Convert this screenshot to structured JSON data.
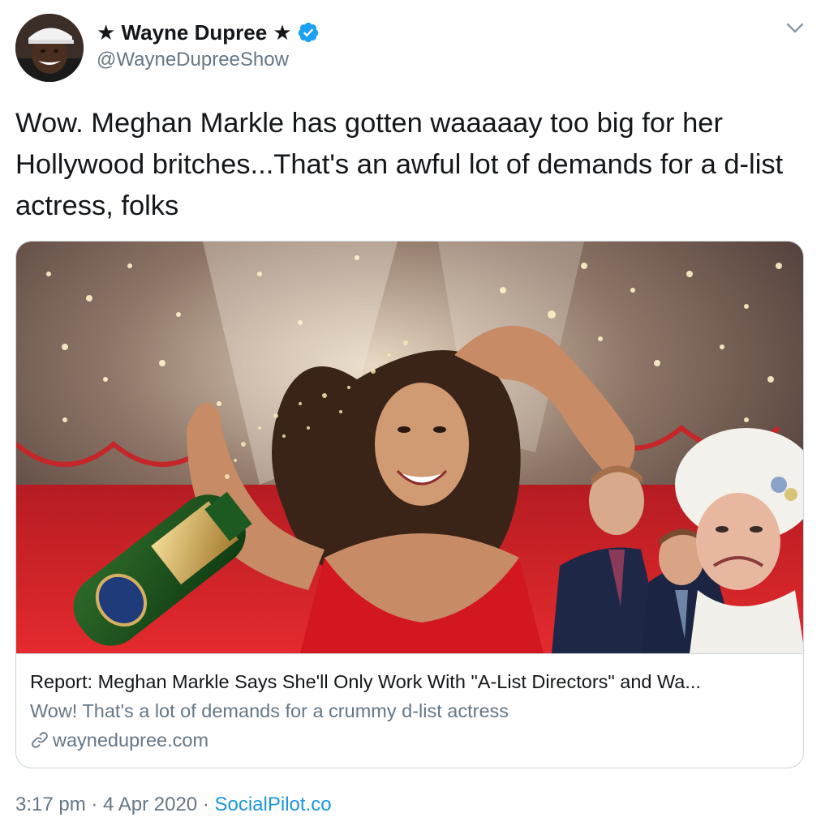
{
  "tweet": {
    "author": {
      "display_name": "★ Wayne Dupree ★",
      "handle": "@WayneDupreeShow",
      "verified": true
    },
    "text": "Wow. Meghan Markle has gotten waaaaay too big for her Hollywood britches...That's an awful lot of demands for a d-list actress, folks",
    "card": {
      "title": "Report: Meghan Markle Says She'll Only Work With \"A-List Directors\" and Wa...",
      "description": "Wow! That's a lot of demands for a crummy d-list actress",
      "domain": "waynedupree.com"
    },
    "meta": {
      "time": "3:17 pm",
      "separator_1": " · ",
      "date": "4 Apr 2020",
      "separator_2": " · ",
      "source": "SocialPilot.co"
    }
  },
  "icons": {
    "verified": "verified-badge-icon",
    "menu": "chevron-down-icon",
    "link": "link-icon"
  },
  "colors": {
    "text_primary": "#14171a",
    "text_secondary": "#657786",
    "link": "#1b95e0",
    "verified": "#1da1f2",
    "border": "#ccd6dd"
  }
}
